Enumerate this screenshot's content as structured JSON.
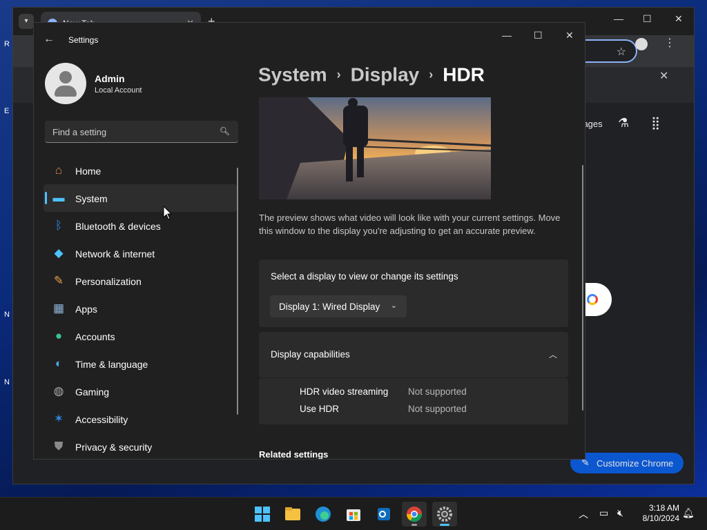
{
  "chrome": {
    "tab_title": "New Tab",
    "images_link": "Images",
    "customize_label": "Customize Chrome"
  },
  "desktop": {
    "icon_letters": [
      "R",
      "E",
      "N",
      "N"
    ]
  },
  "settings": {
    "window_title": "Settings",
    "user": {
      "name": "Admin",
      "account_type": "Local Account"
    },
    "search": {
      "placeholder": "Find a setting"
    },
    "nav": [
      {
        "label": "Home",
        "icon": "home-icon",
        "color": "#e8874f"
      },
      {
        "label": "System",
        "icon": "system-icon",
        "color": "#4cc2ff",
        "active": true
      },
      {
        "label": "Bluetooth & devices",
        "icon": "bluetooth-icon",
        "color": "#2d8cf0"
      },
      {
        "label": "Network & internet",
        "icon": "wifi-icon",
        "color": "#4cc2ff"
      },
      {
        "label": "Personalization",
        "icon": "brush-icon",
        "color": "#e5a04a"
      },
      {
        "label": "Apps",
        "icon": "apps-icon",
        "color": "#8fb4d9"
      },
      {
        "label": "Accounts",
        "icon": "person-icon",
        "color": "#3bbf9a"
      },
      {
        "label": "Time & language",
        "icon": "globe-clock-icon",
        "color": "#4aa8e6"
      },
      {
        "label": "Gaming",
        "icon": "gamepad-icon",
        "color": "#a7a7a7"
      },
      {
        "label": "Accessibility",
        "icon": "accessibility-icon",
        "color": "#2d8cf0"
      },
      {
        "label": "Privacy & security",
        "icon": "shield-icon",
        "color": "#8a8a8a"
      }
    ],
    "breadcrumb": {
      "root": "System",
      "parent": "Display",
      "current": "HDR"
    },
    "preview_description": "The preview shows what video will look like with your current settings. Move this window to the display you're adjusting to get an accurate preview.",
    "display_select": {
      "title": "Select a display to view or change its settings",
      "value": "Display 1: Wired Display"
    },
    "capabilities": {
      "title": "Display capabilities",
      "rows": [
        {
          "label": "HDR video streaming",
          "value": "Not supported"
        },
        {
          "label": "Use HDR",
          "value": "Not supported"
        }
      ]
    },
    "related_heading": "Related settings"
  },
  "taskbar": {
    "apps": [
      "start-button",
      "file-explorer",
      "edge",
      "microsoft-store",
      "outlook-new",
      "chrome",
      "settings"
    ],
    "time": "3:18 AM",
    "date": "8/10/2024"
  },
  "colors": {
    "accent": "#4cc2ff",
    "window_bg": "#202020",
    "card_bg": "#2b2b2b"
  }
}
